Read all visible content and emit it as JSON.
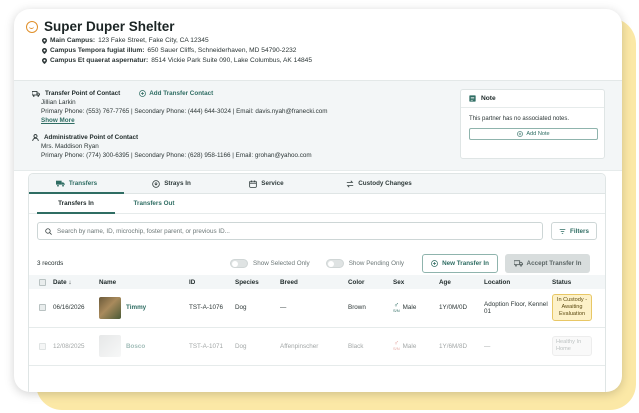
{
  "shelter": {
    "name": "Super Duper Shelter",
    "campuses": [
      {
        "label": "Main Campus:",
        "address": "123 Fake Street, Fake City, CA 12345"
      },
      {
        "label": "Campus Tempora fugiat illum:",
        "address": "650 Sauer Cliffs, Schneiderhaven, MD 54790-2232"
      },
      {
        "label": "Campus Et quaerat aspernatur:",
        "address": "8514 Vickie Park Suite 090, Lake Columbus, AK 14845"
      }
    ]
  },
  "contacts": {
    "transfer": {
      "heading": "Transfer Point of Contact",
      "add_label": "Add Transfer Contact",
      "name": "Jillian Larkin",
      "phones": "Primary Phone: (553) 767-7765 | Secondary Phone: (444) 644-3024 | Email: davis.nyah@franecki.com",
      "show_more": "Show More"
    },
    "admin": {
      "heading": "Administrative Point of Contact",
      "name": "Mrs. Maddison Ryan",
      "phones": "Primary Phone: (774) 300-6395 | Secondary Phone: (628) 958-1166 | Email: grohan@yahoo.com"
    }
  },
  "note": {
    "title": "Note",
    "text": "This partner has no associated notes.",
    "add_label": "Add Note"
  },
  "tabs": [
    {
      "label": "Transfers",
      "icon": "truck-icon"
    },
    {
      "label": "Strays In",
      "icon": "stray-icon"
    },
    {
      "label": "Service",
      "icon": "calendar-icon"
    },
    {
      "label": "Custody Changes",
      "icon": "swap-icon"
    }
  ],
  "subtabs": [
    "Transfers In",
    "Transfers Out"
  ],
  "search": {
    "placeholder": "Search by name, ID, microchip, foster parent, or previous ID...",
    "filters_label": "Filters"
  },
  "controls": {
    "records": "3 records",
    "show_selected": "Show Selected Only",
    "show_pending": "Show Pending Only",
    "new_transfer": "New Transfer In",
    "accept_transfer": "Accept Transfer In"
  },
  "table": {
    "columns": [
      "Date",
      "Name",
      "ID",
      "Species",
      "Breed",
      "Color",
      "Sex",
      "Age",
      "Location",
      "Status"
    ],
    "rows": [
      {
        "date": "06/16/2026",
        "name": "Timmy",
        "id": "TST-A-1076",
        "species": "Dog",
        "breed": "—",
        "color": "Brown",
        "sex": "Male",
        "sex_note": "S/N",
        "age": "1Y/0M/0D",
        "location": "Adoption Floor, Kennel 01",
        "status": "In Custody - Awaiting Evaluation"
      },
      {
        "date": "12/08/2025",
        "name": "Bosco",
        "id": "TST-A-1071",
        "species": "Dog",
        "breed": "Affenpinscher",
        "color": "Black",
        "sex": "Male",
        "sex_note": "S/N",
        "age": "1Y/6M/8D",
        "location": "—",
        "status": "Healthy In Home"
      }
    ]
  },
  "colors": {
    "accent": "#2f6d63",
    "brand": "#e0902b",
    "status_pill": "#fdf1c8"
  }
}
